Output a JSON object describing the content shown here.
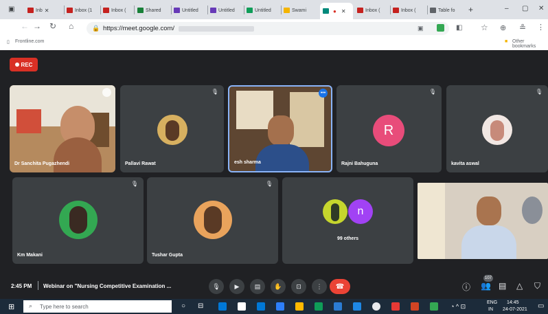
{
  "browser": {
    "tabs": [
      {
        "label": "Inb",
        "icon": "gmail-icon",
        "color": "#c5221f"
      },
      {
        "label": "Inbox (1",
        "icon": "gmail-icon",
        "color": "#c5221f"
      },
      {
        "label": "Inbox (",
        "icon": "gmail-icon",
        "color": "#c5221f"
      },
      {
        "label": "Shared",
        "icon": "drive-icon",
        "color": "#188038"
      },
      {
        "label": "Untitled",
        "icon": "forms-icon",
        "color": "#673ab7"
      },
      {
        "label": "Untitled",
        "icon": "forms-icon",
        "color": "#673ab7"
      },
      {
        "label": "Untitled",
        "icon": "sheets-icon",
        "color": "#0f9d58"
      },
      {
        "label": "Swami",
        "icon": "slides-icon",
        "color": "#f4b400"
      },
      {
        "label": "",
        "icon": "meet-icon",
        "color": "#00897b"
      },
      {
        "label": "Inbox (",
        "icon": "gmail-icon",
        "color": "#c5221f"
      },
      {
        "label": "Inbox (",
        "icon": "gmail-icon",
        "color": "#c5221f"
      },
      {
        "label": "Table fo",
        "icon": "page-icon",
        "color": "#5f6368"
      }
    ],
    "url": "https://meet.google.com/",
    "bookmark_left": "Frontline.com",
    "bookmark_right": "Other bookmarks"
  },
  "meet": {
    "rec_label": "REC",
    "participants": [
      {
        "name": "Dr Sanchita Pugazhendi"
      },
      {
        "name": "Pallavi Rawat"
      },
      {
        "name": "esh sharma"
      },
      {
        "name": "Rajni Bahuguna",
        "initial": "R",
        "avatar_color": "#e84c7a"
      },
      {
        "name": "kavita aswal"
      },
      {
        "name": "Km Makani"
      },
      {
        "name": "Tushar Gupta"
      },
      {
        "name": "99 others",
        "initial": "n",
        "avatar_color": "#a142f4"
      }
    ],
    "time": "2:45 PM",
    "meeting_title": "Webinar on \"Nursing Competitive Examination ...",
    "participant_count": "107"
  },
  "taskbar": {
    "search_placeholder": "Type here to search",
    "lang": "ENG",
    "lang_region": "IN",
    "clock_time": "14:45",
    "clock_date": "24-07-2021"
  }
}
